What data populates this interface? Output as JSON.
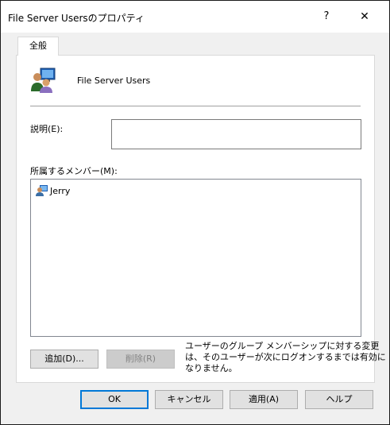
{
  "window": {
    "title": "File Server Usersのプロパティ",
    "help_glyph": "?",
    "close_glyph": "✕"
  },
  "tabs": [
    {
      "label": "全般"
    }
  ],
  "general": {
    "group_name": "File Server Users",
    "description_label": "説明(E):",
    "description_value": "",
    "members_label": "所属するメンバー(M):",
    "members": [
      {
        "name": "Jerry",
        "icon": "user-icon"
      }
    ],
    "add_button": "追加(D)...",
    "remove_button": "削除(R)",
    "note_lines": [
      "ユーザーのグループ メンバーシップに対する変更",
      "は、そのユーザーが次にログオンするまでは有効に",
      "なりません。"
    ]
  },
  "buttons": {
    "ok": "OK",
    "cancel": "キャンセル",
    "apply": "適用(A)",
    "help": "ヘルプ"
  },
  "colors": {
    "focus_border": "#0078d7",
    "dialog_bg": "#f0f0f0"
  }
}
